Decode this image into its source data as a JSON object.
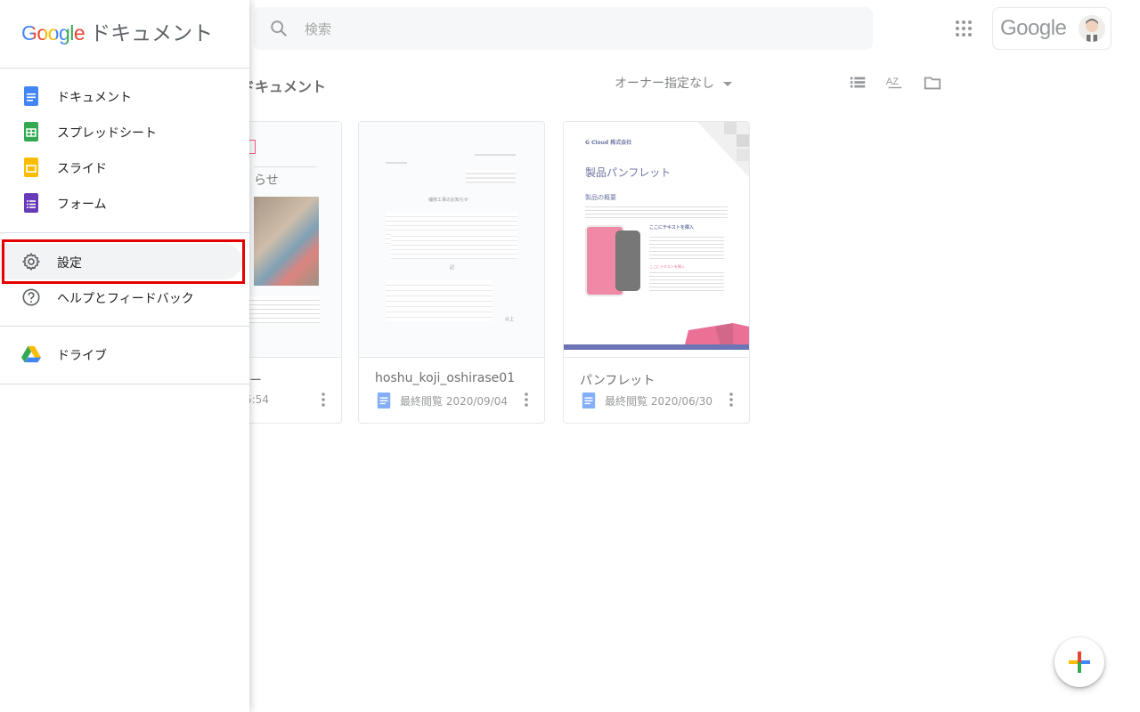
{
  "app": {
    "brand_google": "Google",
    "brand_title": "ドキュメント"
  },
  "search": {
    "placeholder": "検索"
  },
  "account": {
    "logo_text": "Google"
  },
  "toolbar": {
    "section_title": "ドキュメント",
    "owner_filter": "オーナー指定なし",
    "sort_icon_text": "AZ"
  },
  "drawer": {
    "items": [
      {
        "label": "ドキュメント",
        "icon": "docs-icon"
      },
      {
        "label": "スプレッドシート",
        "icon": "sheets-icon"
      },
      {
        "label": "スライド",
        "icon": "slides-icon"
      },
      {
        "label": "フォーム",
        "icon": "forms-icon"
      },
      {
        "label": "設定",
        "icon": "gear-icon"
      },
      {
        "label": "ヘルプとフィードバック",
        "icon": "help-icon"
      },
      {
        "label": "ドライブ",
        "icon": "drive-icon"
      }
    ]
  },
  "documents": [
    {
      "name": "ー",
      "meta": "5:54"
    },
    {
      "name": "hoshu_koji_oshirase01",
      "meta": "最終閲覧 2020/09/04"
    },
    {
      "name": "パンフレット",
      "meta": "最終閲覧 2020/06/30"
    }
  ],
  "thumbs": {
    "doc1": {
      "heading": "らせ"
    },
    "doc2": {
      "title": "補修工事のお知らせ",
      "note": "記",
      "end": "以上"
    },
    "doc3": {
      "company": "G Cloud 株式会社",
      "title": "製品パンフレット",
      "section": "製品の概要",
      "callout": "ここにテキストを挿入",
      "callout2": "ここにテキストを挿入"
    }
  },
  "colors": {
    "blue": "#4285f4",
    "red": "#ea4335",
    "yellow": "#fbbc04",
    "green": "#34a853",
    "highlight": "#e50000"
  }
}
